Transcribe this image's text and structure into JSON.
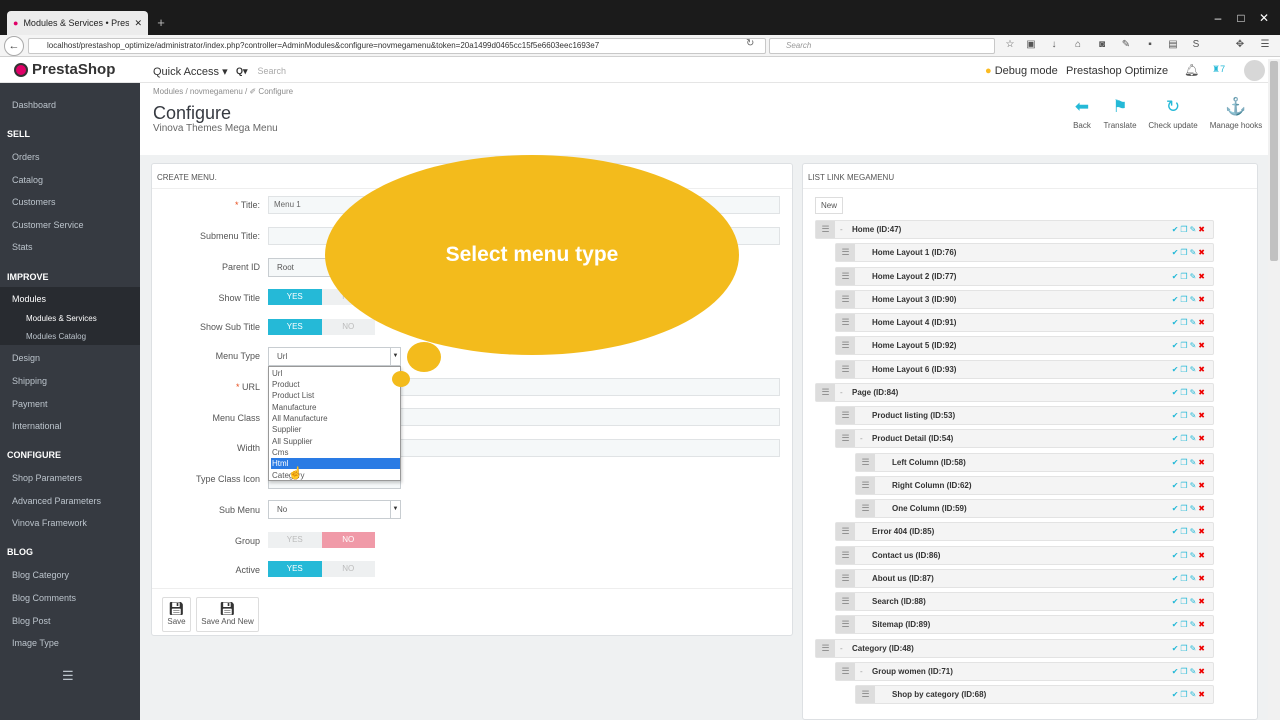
{
  "browser": {
    "tab_title": "Modules & Services • Presta",
    "url": "localhost/prestashop_optimize/administrator/index.php?controller=AdminModules&configure=novmegamenu&token=20a1499d0465cc15f5e6603eec1693e7",
    "search_placeholder": "Search"
  },
  "header": {
    "logo": "PrestaShop",
    "quick_access": "Quick Access ▾",
    "search_placeholder": "Search",
    "debug_mode": "Debug mode",
    "shop_name": "Prestashop Optimize",
    "notif_count": "7"
  },
  "sidebar": {
    "dashboard": "Dashboard",
    "sell": "SELL",
    "orders": "Orders",
    "catalog": "Catalog",
    "customers": "Customers",
    "customer_service": "Customer Service",
    "stats": "Stats",
    "improve": "IMPROVE",
    "modules": "Modules",
    "modules_services": "Modules & Services",
    "modules_catalog": "Modules Catalog",
    "design": "Design",
    "shipping": "Shipping",
    "payment": "Payment",
    "international": "International",
    "configure": "CONFIGURE",
    "shop_parameters": "Shop Parameters",
    "advanced_parameters": "Advanced Parameters",
    "vinova_framework": "Vinova Framework",
    "blog": "BLOG",
    "blog_category": "Blog Category",
    "blog_comments": "Blog Comments",
    "blog_post": "Blog Post",
    "image_type": "Image Type"
  },
  "page": {
    "breadcrumb": "Modules  /  novmegamenu  /  ✐ Configure",
    "title": "Configure",
    "subtitle": "Vinova Themes Mega Menu",
    "toolbar": {
      "back": "Back",
      "translate": "Translate",
      "check_update": "Check update",
      "manage_hooks": "Manage hooks"
    }
  },
  "form": {
    "heading": "CREATE MENU.",
    "title_label": "Title:",
    "title_value": "Menu 1",
    "submenu_title_label": "Submenu Title:",
    "parent_id_label": "Parent ID",
    "parent_id_value": "Root",
    "show_title_label": "Show Title",
    "show_sub_title_label": "Show Sub Title",
    "menu_type_label": "Menu Type",
    "menu_type_value": "Url",
    "url_label": "URL",
    "menu_class_label": "Menu Class",
    "width_label": "Width",
    "type_class_icon_label": "Type Class Icon",
    "sub_menu_label": "Sub Menu",
    "sub_menu_value": "No",
    "group_label": "Group",
    "active_label": "Active",
    "yes": "YES",
    "no": "NO",
    "menu_type_options": [
      "Url",
      "Product",
      "Product List",
      "Manufacture",
      "All Manufacture",
      "Supplier",
      "All Supplier",
      "Cms",
      "Html",
      "Category"
    ],
    "highlighted_option": "Html",
    "save": "Save",
    "save_and_new": "Save And New"
  },
  "callout": {
    "text": "Select menu type"
  },
  "tree": {
    "heading": "LIST LINK MEGAMENU",
    "new_button": "New",
    "items": [
      {
        "label": "Home (ID:47)",
        "level": 0,
        "collapse": "-"
      },
      {
        "label": "Home Layout 1 (ID:76)",
        "level": 1
      },
      {
        "label": "Home Layout 2 (ID:77)",
        "level": 1
      },
      {
        "label": "Home Layout 3 (ID:90)",
        "level": 1
      },
      {
        "label": "Home Layout 4 (ID:91)",
        "level": 1
      },
      {
        "label": "Home Layout 5 (ID:92)",
        "level": 1
      },
      {
        "label": "Home Layout 6 (ID:93)",
        "level": 1
      },
      {
        "label": "Page (ID:84)",
        "level": 0,
        "collapse": "-"
      },
      {
        "label": "Product listing (ID:53)",
        "level": 1
      },
      {
        "label": "Product Detail (ID:54)",
        "level": 1,
        "collapse": "-"
      },
      {
        "label": "Left Column (ID:58)",
        "level": 2
      },
      {
        "label": "Right Column (ID:62)",
        "level": 2
      },
      {
        "label": "One Column (ID:59)",
        "level": 2
      },
      {
        "label": "Error 404 (ID:85)",
        "level": 1
      },
      {
        "label": "Contact us (ID:86)",
        "level": 1
      },
      {
        "label": "About us (ID:87)",
        "level": 1
      },
      {
        "label": "Search (ID:88)",
        "level": 1
      },
      {
        "label": "Sitemap (ID:89)",
        "level": 1
      },
      {
        "label": "Category (ID:48)",
        "level": 0,
        "collapse": "-"
      },
      {
        "label": "Group women (ID:71)",
        "level": 1,
        "collapse": "-"
      },
      {
        "label": "Shop by category (ID:68)",
        "level": 2
      }
    ]
  },
  "colors": {
    "accent": "#25b9d7",
    "sidebar": "#363a41",
    "callout": "#f3bb1c",
    "danger": "#e00000"
  }
}
